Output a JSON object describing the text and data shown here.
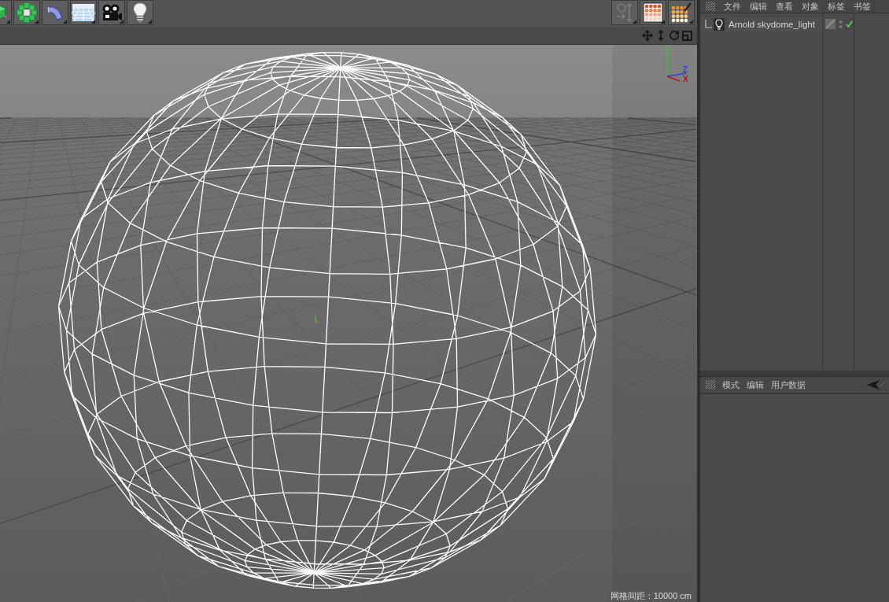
{
  "viewport": {
    "axes": [
      {
        "label": "Y",
        "color": "#3fbf3f"
      },
      {
        "label": "Z",
        "color": "#2f3fe0"
      },
      {
        "label": "X",
        "color": "#a81818"
      }
    ],
    "grid_spacing": "网格间距：10000 cm"
  },
  "object_manager": {
    "menu": [
      "文件",
      "编辑",
      "查看",
      "对象",
      "标签",
      "书签"
    ],
    "objects": [
      {
        "name": "Arnold skydome_light",
        "enabled": true
      }
    ]
  },
  "attribute_manager": {
    "menu": [
      "模式",
      "编辑",
      "用户数据"
    ]
  }
}
